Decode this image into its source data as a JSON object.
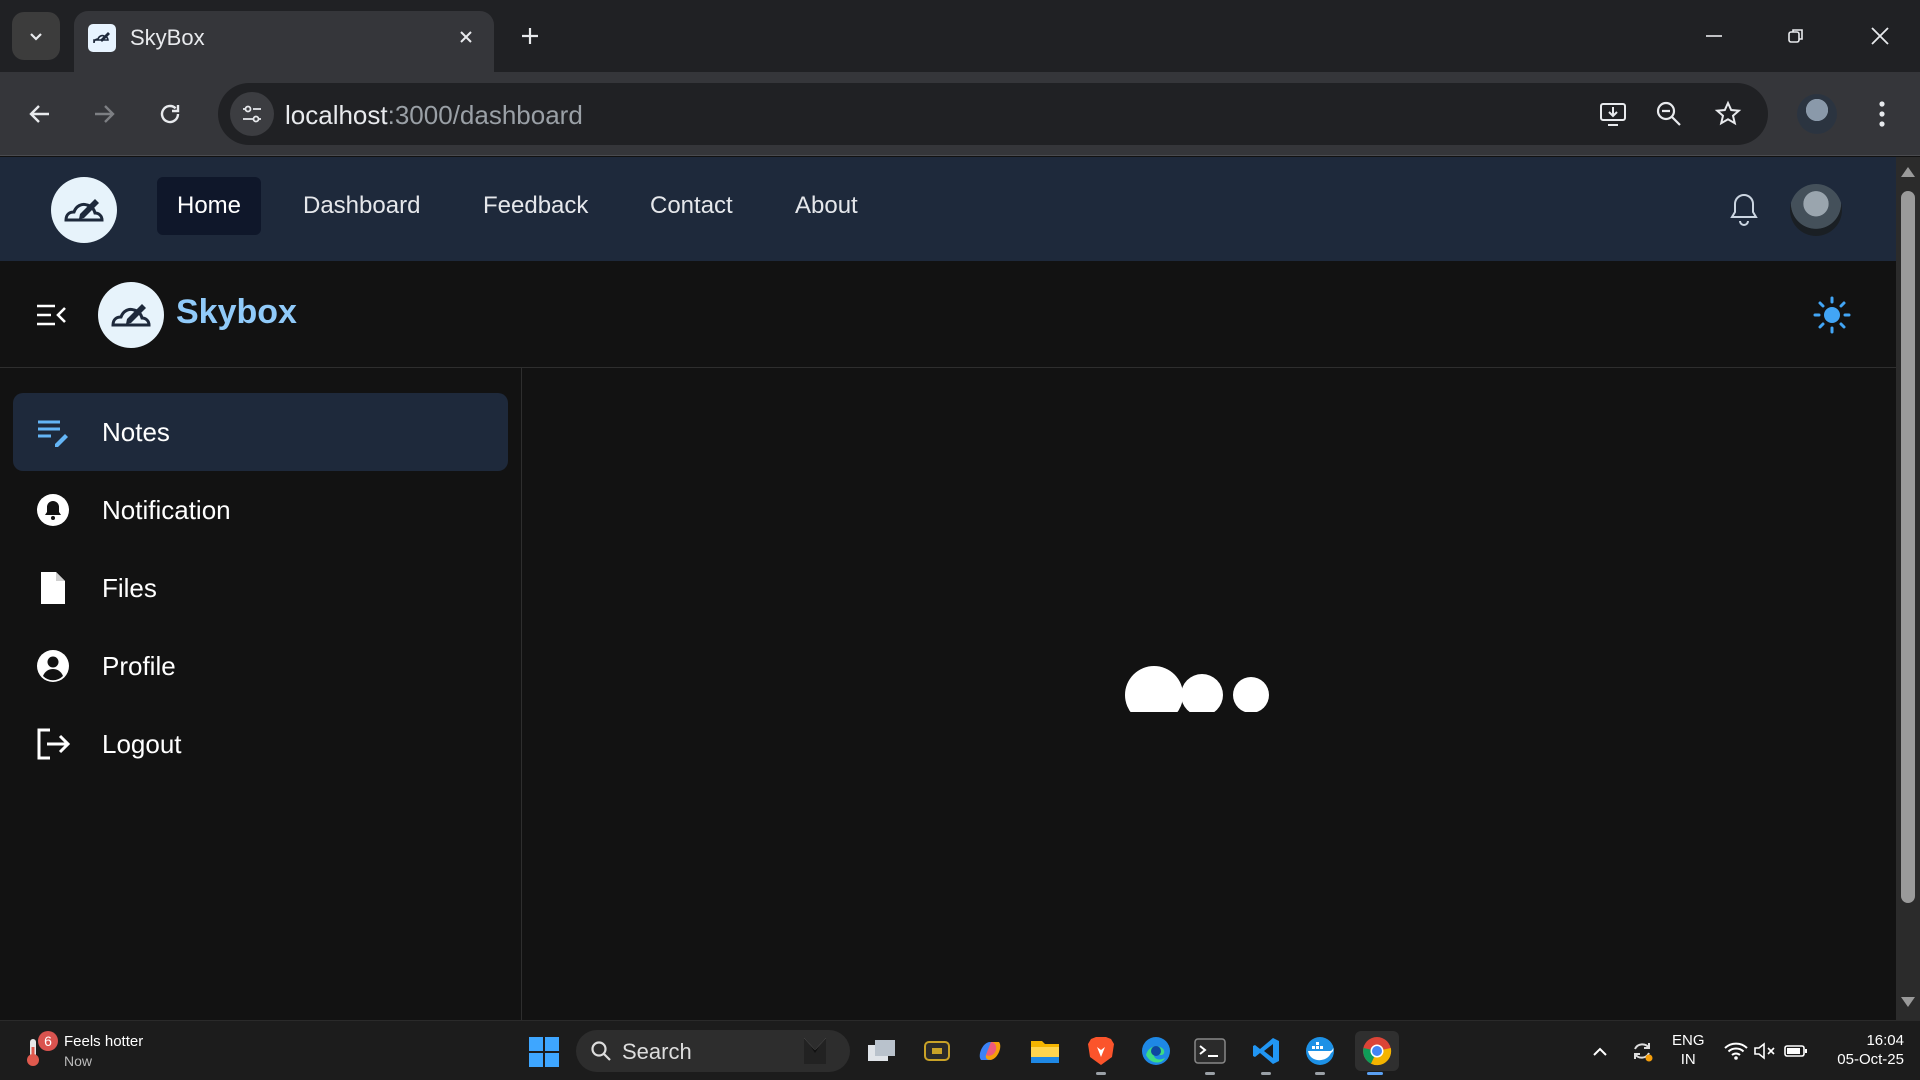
{
  "browser": {
    "tab_title": "SkyBox",
    "url_host": "localhost",
    "url_rest": ":3000/dashboard"
  },
  "topnav": {
    "links": [
      "Home",
      "Dashboard",
      "Feedback",
      "Contact",
      "About"
    ],
    "active": "Home"
  },
  "appbar": {
    "brand": "Skybox"
  },
  "sidebar": {
    "items": [
      {
        "label": "Notes",
        "icon": "notes-icon",
        "active": true
      },
      {
        "label": "Notification",
        "icon": "bell-icon",
        "active": false
      },
      {
        "label": "Files",
        "icon": "file-icon",
        "active": false
      },
      {
        "label": "Profile",
        "icon": "account-circle-icon",
        "active": false
      },
      {
        "label": "Logout",
        "icon": "logout-icon",
        "active": false
      }
    ]
  },
  "taskbar": {
    "weather_badge": "6",
    "weather_title": "Feels hotter",
    "weather_sub": "Now",
    "search_label": "Search",
    "lang_line1": "ENG",
    "lang_line2": "IN",
    "time": "16:04",
    "date": "05-Oct-25"
  },
  "colors": {
    "nav_bg": "#1e293b",
    "accent": "#90caf9",
    "sun": "#42a5f5",
    "notes_icon": "#64b5f6"
  }
}
